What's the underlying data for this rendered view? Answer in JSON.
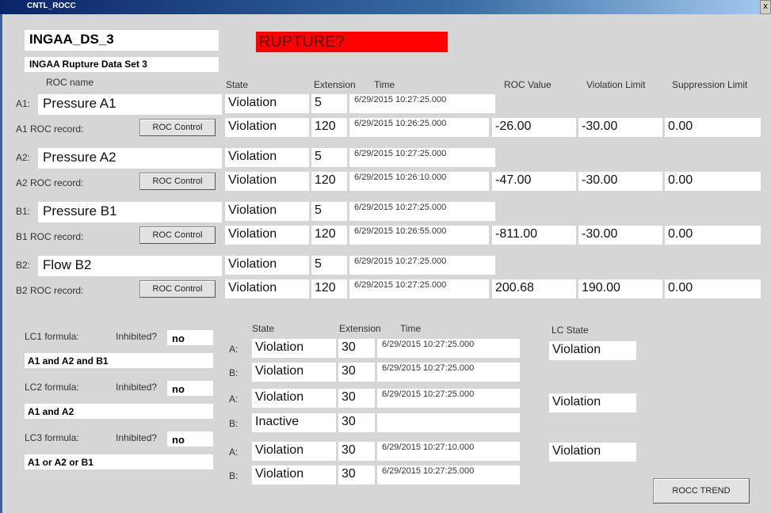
{
  "window": {
    "title": "CNTL_ROCC",
    "close": "x"
  },
  "header": {
    "name": "INGAA_DS_3",
    "subtitle": "INGAA Rupture Data Set 3",
    "alert": "RUPTURE?"
  },
  "roc_headers": {
    "name": "ROC name",
    "state": "State",
    "extension": "Extension",
    "time": "Time",
    "value": "ROC Value",
    "violation": "Violation Limit",
    "suppression": "Suppression Limit"
  },
  "roc": [
    {
      "label": "A1:",
      "name": "Pressure A1",
      "state": "Violation",
      "ext": "5",
      "time": "6/29/2015 10:27:25.000",
      "rec_label": "A1 ROC record:",
      "button": "ROC Control",
      "rec_state": "Violation",
      "rec_ext": "120",
      "rec_time": "6/29/2015 10:26:25.000",
      "value": "-26.00",
      "violation": "-30.00",
      "suppression": "0.00"
    },
    {
      "label": "A2:",
      "name": "Pressure A2",
      "state": "Violation",
      "ext": "5",
      "time": "6/29/2015 10:27:25.000",
      "rec_label": "A2 ROC record:",
      "button": "ROC Control",
      "rec_state": "Violation",
      "rec_ext": "120",
      "rec_time": "6/29/2015 10:26:10.000",
      "value": "-47.00",
      "violation": "-30.00",
      "suppression": "0.00"
    },
    {
      "label": "B1:",
      "name": "Pressure B1",
      "state": "Violation",
      "ext": "5",
      "time": "6/29/2015 10:27:25.000",
      "rec_label": "B1 ROC record:",
      "button": "ROC Control",
      "rec_state": "Violation",
      "rec_ext": "120",
      "rec_time": "6/29/2015 10:26:55.000",
      "value": "-811.00",
      "violation": "-30.00",
      "suppression": "0.00"
    },
    {
      "label": "B2:",
      "name": "Flow B2",
      "state": "Violation",
      "ext": "5",
      "time": "6/29/2015 10:27:25.000",
      "rec_label": "B2 ROC record:",
      "button": "ROC Control",
      "rec_state": "Violation",
      "rec_ext": "120",
      "rec_time": "6/29/2015 10:27:25.000",
      "value": "200.68",
      "violation": "190.00",
      "suppression": "0.00"
    }
  ],
  "lc_headers": {
    "state": "State",
    "extension": "Extension",
    "time": "Time",
    "lc_state": "LC State"
  },
  "lc": [
    {
      "formula_label": "LC1 formula:",
      "inhibited_label": "Inhibited?",
      "inhibited": "no",
      "formula": "A1 and A2 and B1",
      "a_label": "A:",
      "a_state": "Violation",
      "a_ext": "30",
      "a_time": "6/29/2015 10:27:25.000",
      "b_label": "B:",
      "b_state": "Violation",
      "b_ext": "30",
      "b_time": "6/29/2015 10:27:25.000",
      "lc_state": "Violation"
    },
    {
      "formula_label": "LC2 formula:",
      "inhibited_label": "Inhibited?",
      "inhibited": "no",
      "formula": "A1 and A2",
      "a_label": "A:",
      "a_state": "Violation",
      "a_ext": "30",
      "a_time": "6/29/2015 10:27:25.000",
      "b_label": "B:",
      "b_state": "Inactive",
      "b_ext": "30",
      "b_time": "",
      "lc_state": "Violation"
    },
    {
      "formula_label": "LC3 formula:",
      "inhibited_label": "Inhibited?",
      "inhibited": "no",
      "formula": "A1 or A2 or B1",
      "a_label": "A:",
      "a_state": "Violation",
      "a_ext": "30",
      "a_time": "6/29/2015 10:27:10.000",
      "b_label": "B:",
      "b_state": "Violation",
      "b_ext": "30",
      "b_time": "6/29/2015 10:27:25.000",
      "lc_state": "Violation"
    }
  ],
  "footer": {
    "trend_button": "ROCC TREND"
  },
  "colors": {
    "alert": "#ff0000",
    "background": "#d6d6d6",
    "title_bar": "#0a246a"
  }
}
